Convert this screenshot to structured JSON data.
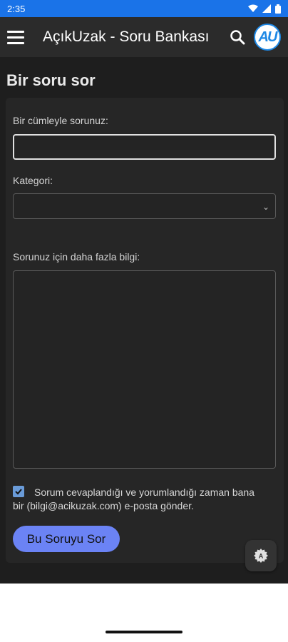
{
  "status_bar": {
    "time": "2:35"
  },
  "app_bar": {
    "title": "AçıkUzak - Soru Bankası",
    "avatar_text": "AU"
  },
  "page": {
    "title": "Bir soru sor"
  },
  "form": {
    "question_label": "Bir cümleyle sorunuz:",
    "question_value": "",
    "category_label": "Kategori:",
    "category_value": "",
    "details_label": "Sorunuz için daha fazla bilgi:",
    "details_value": "",
    "notify_checked": true,
    "notify_text": "Sorum cevaplandığı ve yorumlandığı zaman bana bir (bilgi@acikuzak.com) e-posta gönder.",
    "submit_label": "Bu Soruyu Sor"
  },
  "colors": {
    "status_bar": "#1a73e8",
    "app_bar": "#2b2b2b",
    "background": "#1e1e1e",
    "card": "#262626",
    "submit_button": "#6b83f5",
    "checkbox": "#6a9bd8"
  }
}
